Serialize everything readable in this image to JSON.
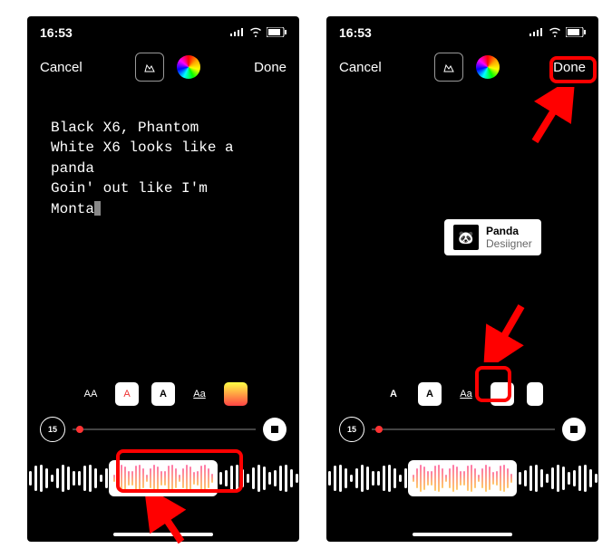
{
  "colors": {
    "accent": "#ff0000"
  },
  "left": {
    "status": {
      "time": "16:53"
    },
    "top": {
      "cancel": "Cancel",
      "done": "Done"
    },
    "lyrics": "Black X6, Phantom\nWhite X6 looks like a\npanda\nGoin' out like I'm\nMonta",
    "timeline": {
      "duration": "15"
    },
    "styles": {
      "s1": "AA",
      "s2": "A",
      "s3": "A",
      "s4": "Aa",
      "s5": ""
    }
  },
  "right": {
    "status": {
      "time": "16:53"
    },
    "top": {
      "cancel": "Cancel",
      "done": "Done"
    },
    "music": {
      "title": "Panda",
      "artist": "Desiigner"
    },
    "timeline": {
      "duration": "15"
    },
    "styles": {
      "s1": "A",
      "s2": "A",
      "s3": "Aa",
      "s4": "",
      "s5": ""
    }
  }
}
